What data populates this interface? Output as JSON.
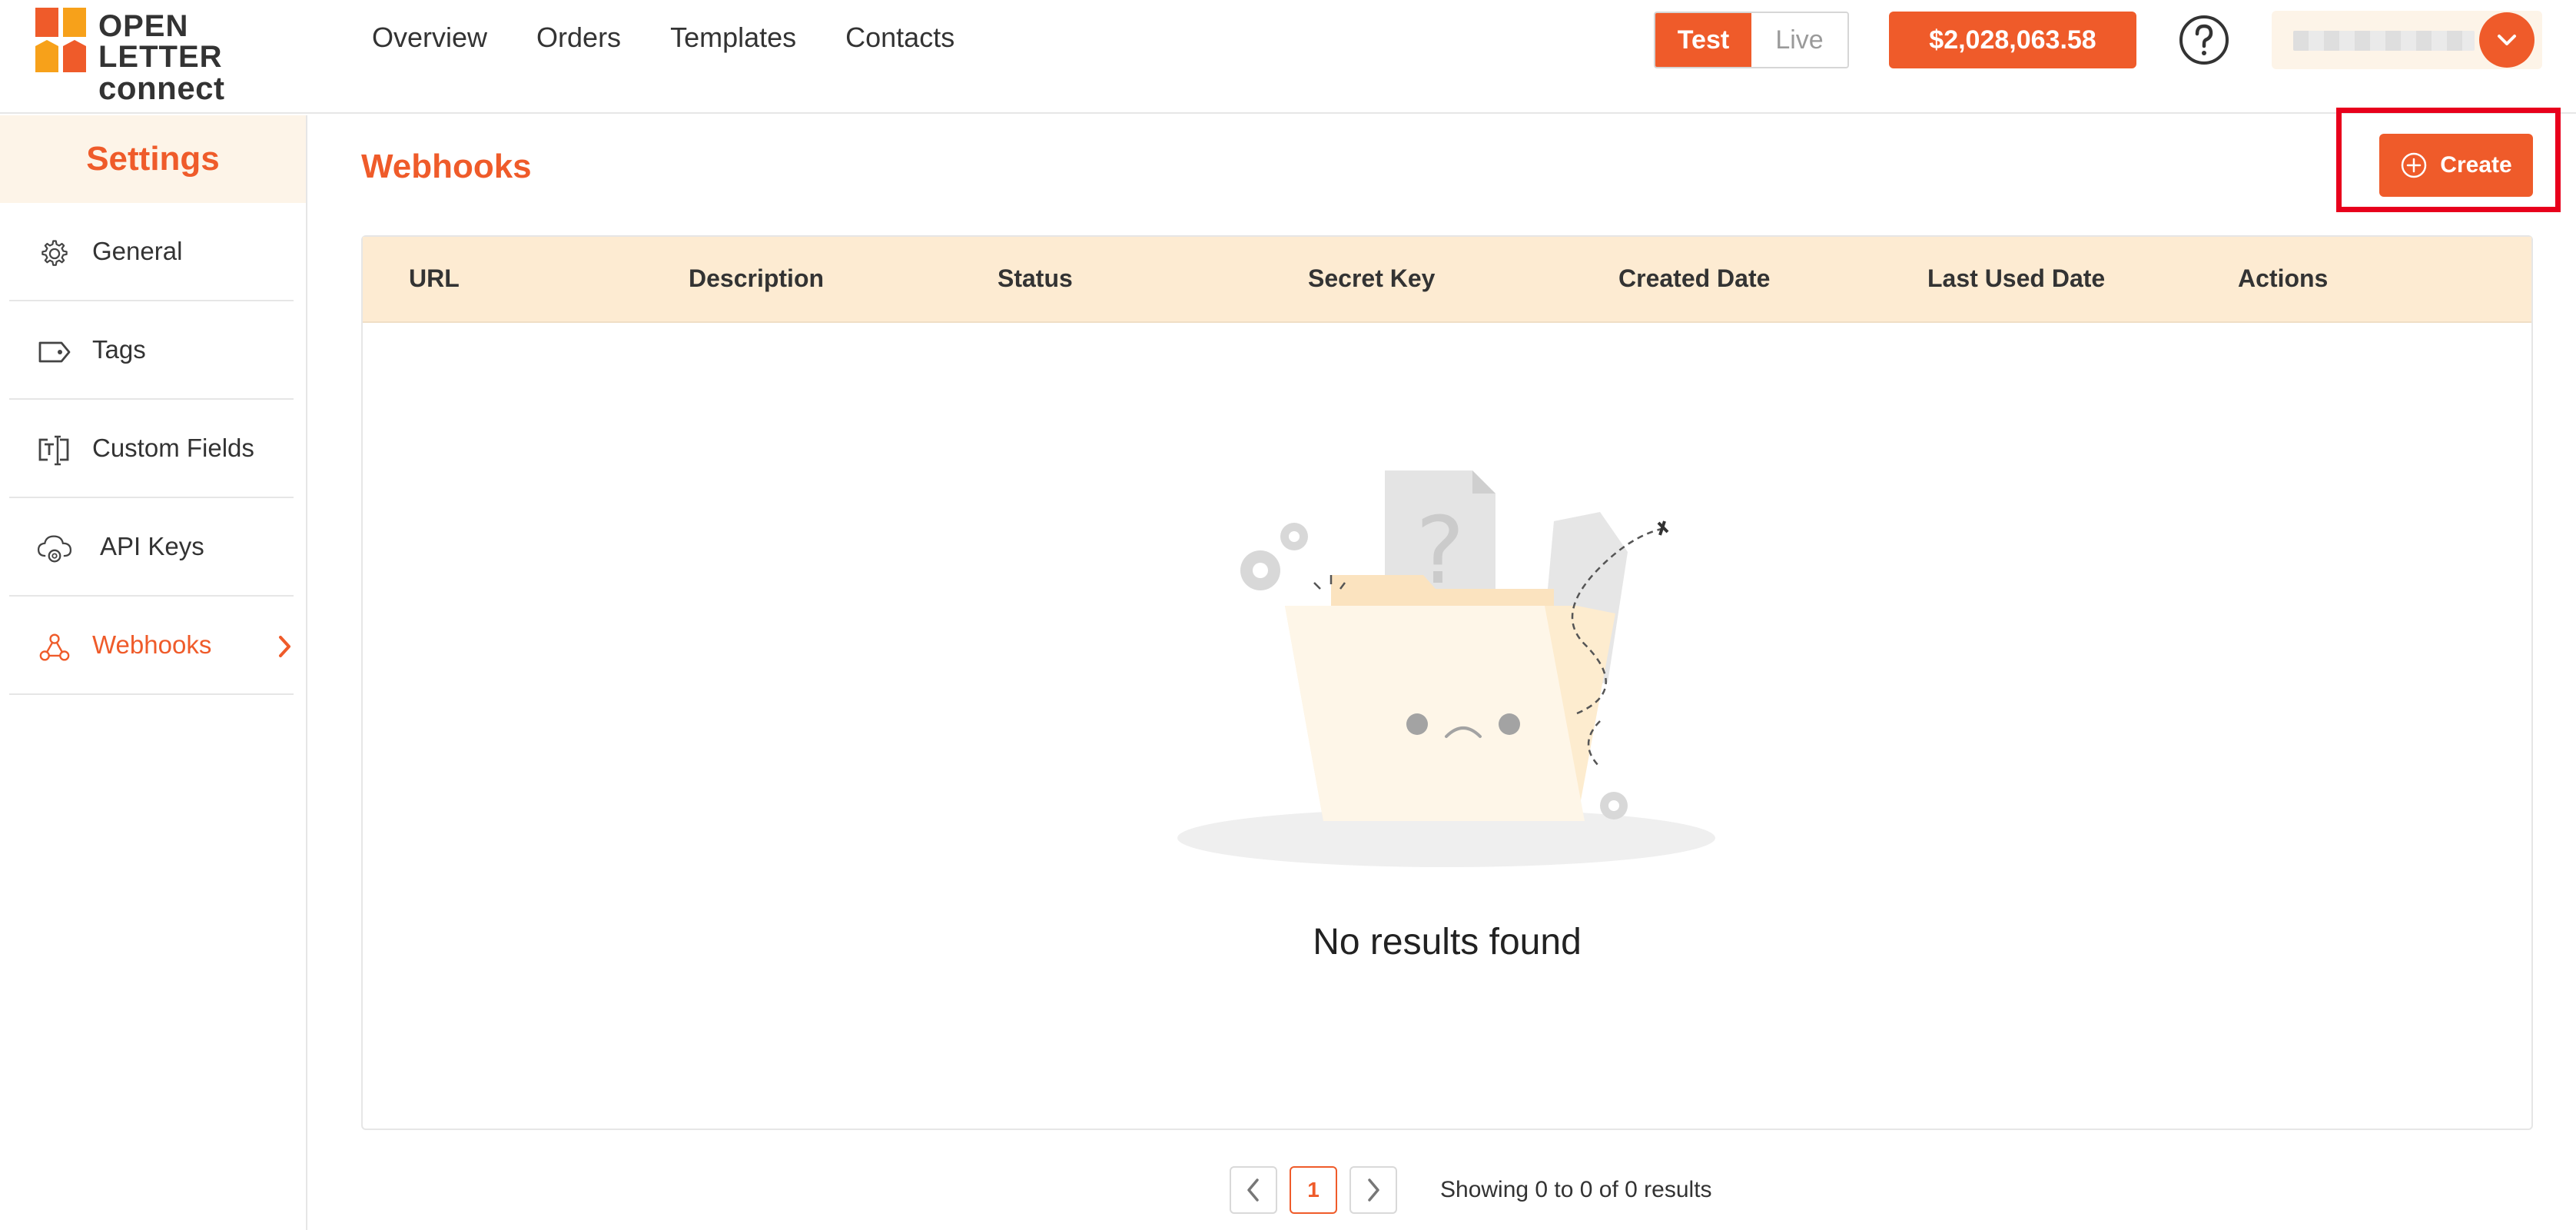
{
  "brand": {
    "line1": "OPEN LETTER",
    "line2": "connect"
  },
  "nav": [
    "Overview",
    "Orders",
    "Templates",
    "Contacts"
  ],
  "mode": {
    "test_label": "Test",
    "live_label": "Live",
    "active": "Test"
  },
  "balance": "$2,028,063.58",
  "sidebar": {
    "title": "Settings",
    "items": [
      {
        "label": "General",
        "icon": "gear-icon"
      },
      {
        "label": "Tags",
        "icon": "tag-icon"
      },
      {
        "label": "Custom Fields",
        "icon": "text-field-icon"
      },
      {
        "label": "API Keys",
        "icon": "cloud-gear-icon"
      },
      {
        "label": "Webhooks",
        "icon": "webhook-icon",
        "active": true
      }
    ]
  },
  "main": {
    "title": "Webhooks",
    "create_label": "Create",
    "columns": [
      "URL",
      "Description",
      "Status",
      "Secret Key",
      "Created Date",
      "Last Used Date",
      "Actions"
    ],
    "empty_text": "No results found"
  },
  "pagination": {
    "current_page": "1",
    "info": "Showing 0 to 0 of 0 results"
  },
  "colors": {
    "accent": "#ef5b2a",
    "header_bg": "#fdebd2",
    "sidebar_head_bg": "#fdf4e8",
    "highlight": "#e8001c"
  }
}
